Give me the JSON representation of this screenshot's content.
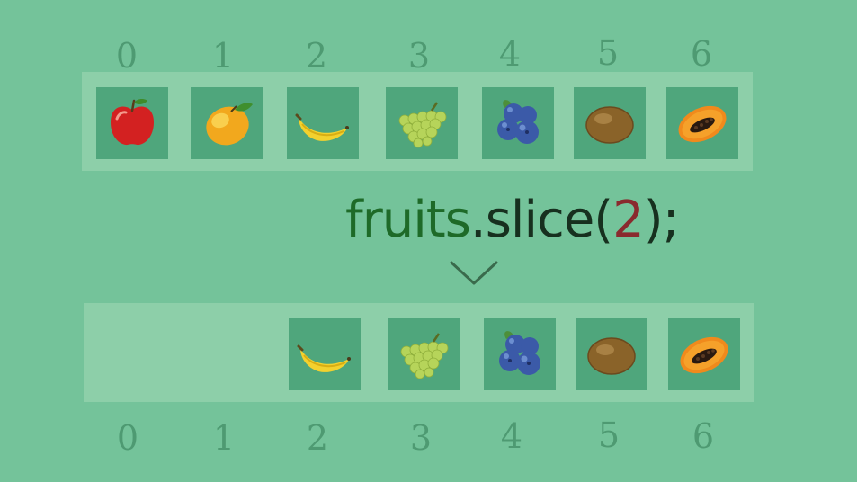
{
  "top_indices": [
    "0",
    "1",
    "2",
    "3",
    "4",
    "5",
    "6"
  ],
  "bottom_indices": [
    "0",
    "1",
    "2",
    "3",
    "4",
    "5",
    "6"
  ],
  "top_row": [
    {
      "fruit": "apple-icon"
    },
    {
      "fruit": "mango-icon"
    },
    {
      "fruit": "banana-icon"
    },
    {
      "fruit": "grapes-icon"
    },
    {
      "fruit": "blueberries-icon"
    },
    {
      "fruit": "kiwi-icon"
    },
    {
      "fruit": "papaya-icon"
    }
  ],
  "bottom_row": [
    {
      "fruit": "banana-icon",
      "index": 2
    },
    {
      "fruit": "grapes-icon",
      "index": 3
    },
    {
      "fruit": "blueberries-icon",
      "index": 4
    },
    {
      "fruit": "kiwi-icon",
      "index": 5
    },
    {
      "fruit": "papaya-icon",
      "index": 6
    }
  ],
  "code": {
    "object": "fruits",
    "dot": ".",
    "method": "slice",
    "open_paren": "(",
    "argument": "2",
    "close_paren": ")",
    "semicolon": ";"
  },
  "colors": {
    "background": "#74c39a",
    "strip": "#8dcfa9",
    "cell": "#4fa67c",
    "index_text": "#4e9a72",
    "code_name": "#1e6a28",
    "code_punct": "#17301f",
    "code_number": "#8a2a2e"
  }
}
